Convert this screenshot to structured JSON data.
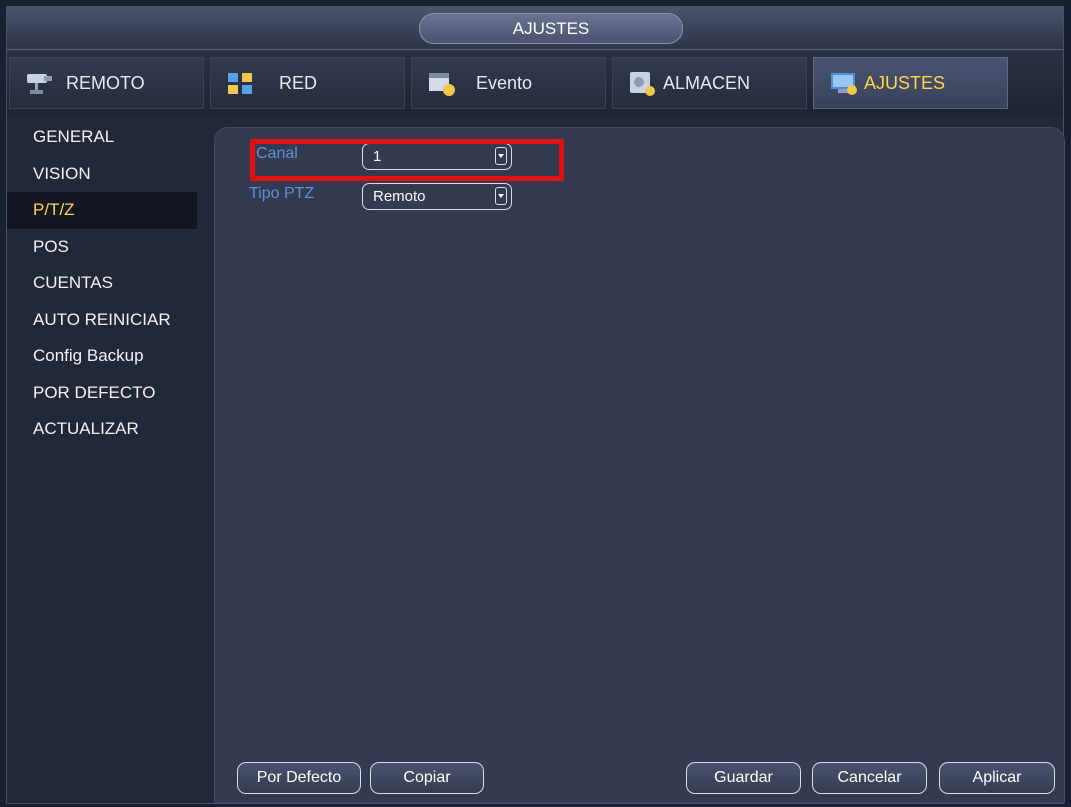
{
  "window": {
    "title": "AJUSTES"
  },
  "tabs": [
    {
      "label": "REMOTO",
      "icon": "camera-icon"
    },
    {
      "label": "RED",
      "icon": "network-icon"
    },
    {
      "label": "Evento",
      "icon": "event-icon"
    },
    {
      "label": "ALMACEN",
      "icon": "storage-icon"
    },
    {
      "label": "AJUSTES",
      "icon": "settings-icon",
      "active": true
    }
  ],
  "sidebar": {
    "items": [
      {
        "label": "GENERAL"
      },
      {
        "label": "VISION"
      },
      {
        "label": "P/T/Z",
        "active": true
      },
      {
        "label": "POS"
      },
      {
        "label": "CUENTAS"
      },
      {
        "label": "AUTO REINICIAR"
      },
      {
        "label": "Config Backup"
      },
      {
        "label": "POR DEFECTO"
      },
      {
        "label": "ACTUALIZAR"
      }
    ]
  },
  "form": {
    "canal": {
      "label": "Canal",
      "value": "1"
    },
    "tipo_ptz": {
      "label": "Tipo PTZ",
      "value": "Remoto"
    }
  },
  "buttons": {
    "default": "Por Defecto",
    "copy": "Copiar",
    "save": "Guardar",
    "cancel": "Cancelar",
    "apply": "Aplicar"
  },
  "colors": {
    "active_text": "#ffd54a",
    "label_blue": "#5e8fd6",
    "highlight": "#e01010"
  }
}
